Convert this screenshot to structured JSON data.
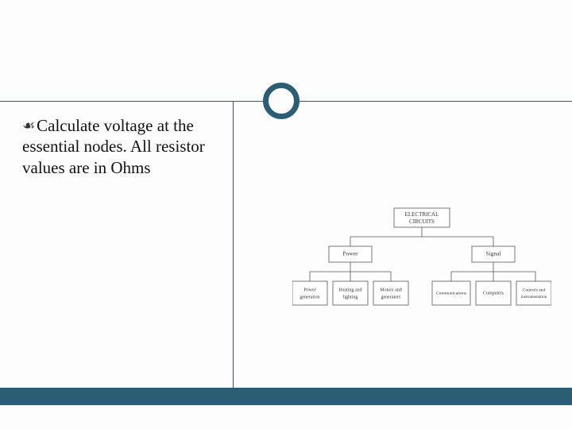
{
  "bullet": {
    "marker": "☙",
    "text": "Calculate voltage at the essential nodes. All resistor values are in Ohms"
  },
  "chart_data": {
    "type": "tree",
    "root": "ELECTRICAL CIRCUITS",
    "children": [
      {
        "label": "Power",
        "children": [
          "Power generation",
          "Heating and lighting",
          "Motors and generators"
        ]
      },
      {
        "label": "Signal",
        "children": [
          "Communications",
          "Computers",
          "Controls and instrumentation"
        ]
      }
    ]
  },
  "colors": {
    "accent": "#2b5d73"
  }
}
